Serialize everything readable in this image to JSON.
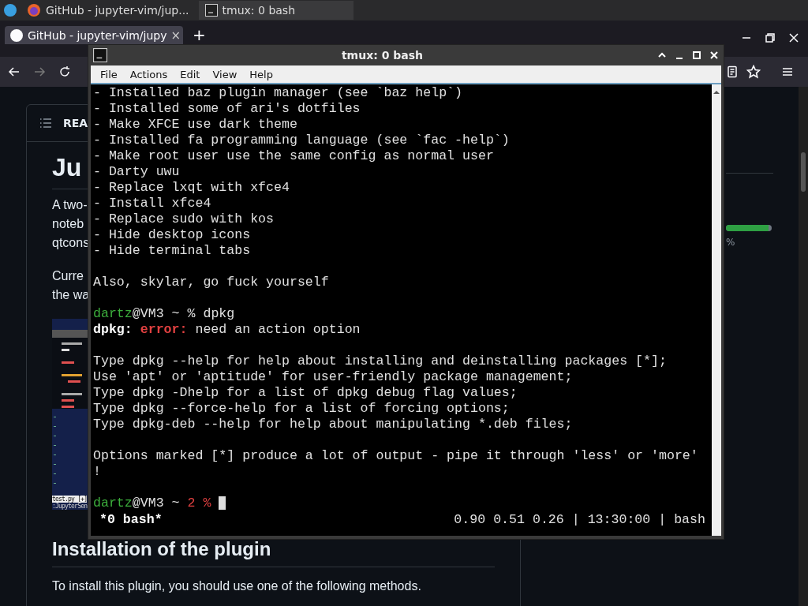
{
  "taskbar": {
    "tasks": [
      {
        "label": "GitHub - jupyter-vim/jup...",
        "kind": "browser",
        "selected": false
      },
      {
        "label": "tmux: 0 bash",
        "kind": "terminal",
        "selected": true
      }
    ]
  },
  "browser": {
    "tab": {
      "label": "GitHub - jupyter-vim/jupy",
      "close": "×"
    },
    "new_tab": "+"
  },
  "page": {
    "readme_header": "REA",
    "heading": "Ju",
    "paragraph_1": [
      "A two-",
      "noteb",
      "qtcons"
    ],
    "paragraph_2": [
      "Curre",
      "the wa"
    ],
    "editor_status": "test.py [+]",
    "editor_command": ":JupyterSen",
    "heading_2": "Installation of the plugin",
    "paragraph_3": "To install this plugin, you should use one of the following methods.",
    "language_bar": {
      "level": 0.93
    },
    "language_percent": "%"
  },
  "terminal": {
    "title": "tmux: 0 bash",
    "menu": [
      "File",
      "Actions",
      "Edit",
      "View",
      "Help"
    ],
    "lines": [
      {
        "kind": "text",
        "segments": [
          {
            "kind": "plain",
            "text": "- Installed baz plugin manager (see `baz help`)"
          }
        ]
      },
      {
        "kind": "text",
        "segments": [
          {
            "kind": "plain",
            "text": "- Installed some of ari's dotfiles"
          }
        ]
      },
      {
        "kind": "text",
        "segments": [
          {
            "kind": "plain",
            "text": "- Make XFCE use dark theme"
          }
        ]
      },
      {
        "kind": "text",
        "segments": [
          {
            "kind": "plain",
            "text": "- Installed fa programming language (see `fac -help`)"
          }
        ]
      },
      {
        "kind": "text",
        "segments": [
          {
            "kind": "plain",
            "text": "- Make root user use the same config as normal user"
          }
        ]
      },
      {
        "kind": "text",
        "segments": [
          {
            "kind": "plain",
            "text": "- Darty uwu"
          }
        ]
      },
      {
        "kind": "text",
        "segments": [
          {
            "kind": "plain",
            "text": "- Replace lxqt with xfce4"
          }
        ]
      },
      {
        "kind": "text",
        "segments": [
          {
            "kind": "plain",
            "text": "- Install xfce4"
          }
        ]
      },
      {
        "kind": "text",
        "segments": [
          {
            "kind": "plain",
            "text": "- Replace sudo with kos"
          }
        ]
      },
      {
        "kind": "text",
        "segments": [
          {
            "kind": "plain",
            "text": "- Hide desktop icons"
          }
        ]
      },
      {
        "kind": "text",
        "segments": [
          {
            "kind": "plain",
            "text": "- Hide terminal tabs"
          }
        ]
      },
      {
        "kind": "blank"
      },
      {
        "kind": "text",
        "segments": [
          {
            "kind": "plain",
            "text": "Also, skylar, go fuck yourself"
          }
        ]
      },
      {
        "kind": "blank"
      },
      {
        "kind": "text",
        "segments": [
          {
            "kind": "user",
            "text": "dartz"
          },
          {
            "kind": "plain",
            "text": "@VM3 ~ % dpkg"
          }
        ]
      },
      {
        "kind": "text",
        "segments": [
          {
            "kind": "bold",
            "text": "dpkg: "
          },
          {
            "kind": "error",
            "text": "error:"
          },
          {
            "kind": "plain",
            "text": " need an action option"
          }
        ]
      },
      {
        "kind": "blank"
      },
      {
        "kind": "text",
        "segments": [
          {
            "kind": "plain",
            "text": "Type dpkg --help for help about installing and deinstalling packages [*];"
          }
        ]
      },
      {
        "kind": "text",
        "segments": [
          {
            "kind": "plain",
            "text": "Use 'apt' or 'aptitude' for user-friendly package management;"
          }
        ]
      },
      {
        "kind": "text",
        "segments": [
          {
            "kind": "plain",
            "text": "Type dpkg -Dhelp for a list of dpkg debug flag values;"
          }
        ]
      },
      {
        "kind": "text",
        "segments": [
          {
            "kind": "plain",
            "text": "Type dpkg --force-help for a list of forcing options;"
          }
        ]
      },
      {
        "kind": "text",
        "segments": [
          {
            "kind": "plain",
            "text": "Type dpkg-deb --help for help about manipulating *.deb files;"
          }
        ]
      },
      {
        "kind": "blank"
      },
      {
        "kind": "text",
        "segments": [
          {
            "kind": "plain",
            "text": "Options marked [*] produce a lot of output - pipe it through 'less' or 'more'"
          }
        ]
      },
      {
        "kind": "text",
        "segments": [
          {
            "kind": "plain",
            "text": "!"
          }
        ]
      },
      {
        "kind": "blank"
      },
      {
        "kind": "prompt",
        "segments": [
          {
            "kind": "user",
            "text": "dartz"
          },
          {
            "kind": "plain",
            "text": "@VM3 ~ "
          },
          {
            "kind": "error_code",
            "text": "2 %"
          }
        ]
      }
    ],
    "status_left": "*0 bash*",
    "status_right": "0.90 0.51 0.26 | 13:30:00 | bash"
  }
}
